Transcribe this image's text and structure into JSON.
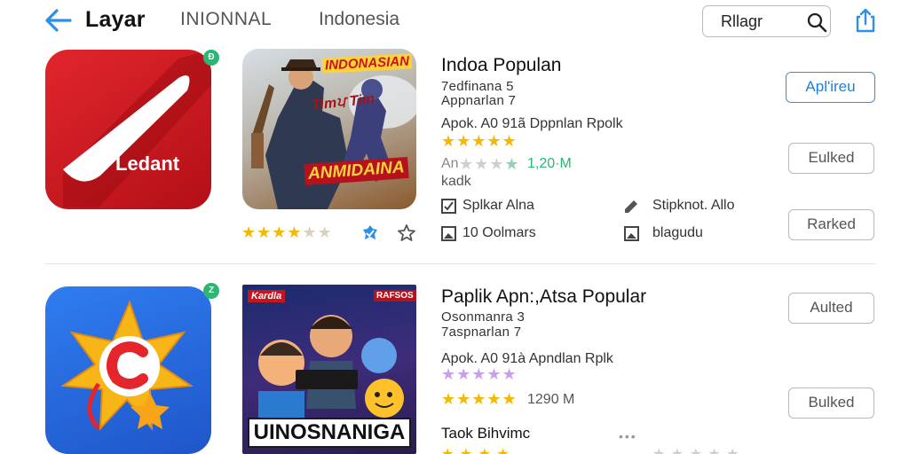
{
  "header": {
    "title": "Layar",
    "tabs": [
      "INIONNAL",
      "Indonesia"
    ],
    "search_text": "Rllagr"
  },
  "colors": {
    "accent": "#1f7fd6",
    "star_gold": "#f5b800",
    "star_purple": "#c9a0e8",
    "badge_green": "#2bb673"
  },
  "rows": [
    {
      "icon_text": "Ledant",
      "badge": "Ð",
      "banner_top": "INDONASIAN",
      "banner_mid": "Timਪ Tim",
      "banner_bottom": "ANMIDAINA",
      "title": "Indoa Populan",
      "sub1": "7edfinana 5",
      "sub2": "Appnarlan 7",
      "desc": "Apok. A0 91ã Dppnlan Rpolk",
      "rating_stars": 5,
      "meta_prefix": "An",
      "meta_size": "1,20·M",
      "meta_suffix": "kadk",
      "features": [
        {
          "icon": "checkbox-icon",
          "text": "Splkar Alna"
        },
        {
          "icon": "pencil-icon",
          "text": "Stipknot. Allo"
        },
        {
          "icon": "image-icon",
          "text": "10 Oolmars"
        },
        {
          "icon": "image-icon",
          "text": "blagudu"
        }
      ],
      "icon_rating_stars": 4,
      "buttons": [
        "Apl'ireu",
        "Eulked",
        "Rarked"
      ]
    },
    {
      "icon_text": "C",
      "badge": "Z",
      "banner_top": "Kardla",
      "banner_tag": "RAFSOS",
      "banner_bottom": "UINOSNANIGA",
      "title": "Paplik Apn:,Atsa Popular",
      "sub1": "Osonmanra 3",
      "sub2": "7aspnarlan 7",
      "desc": "Apok. A0 91à Apndlan Rplk",
      "rating_stars": 5,
      "meta_size": "1290 M",
      "feature_title": "Taok Bihvimc",
      "buttons": [
        "Aulted",
        "Bulked"
      ]
    }
  ]
}
